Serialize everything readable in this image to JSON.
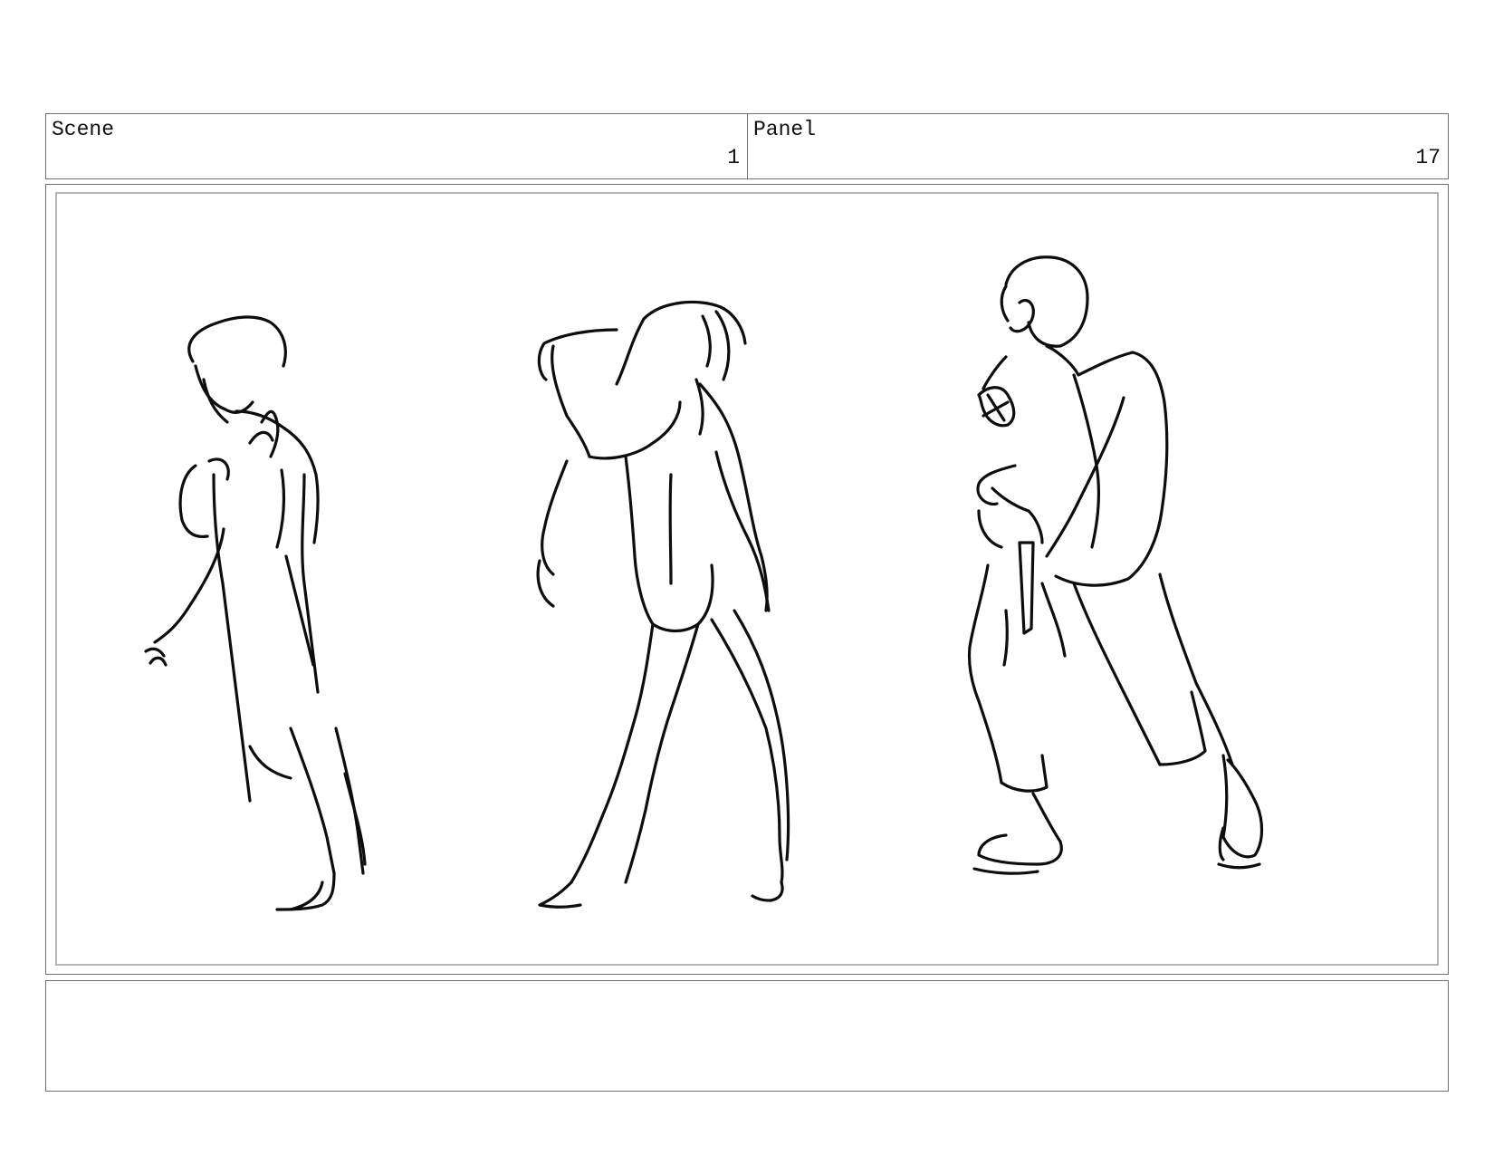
{
  "header": {
    "scene_label": "Scene",
    "scene_number": "1",
    "panel_label": "Panel",
    "panel_number": "17"
  },
  "panel_image": {
    "content": "three-figure-sketch"
  },
  "notes": {
    "text": ""
  }
}
